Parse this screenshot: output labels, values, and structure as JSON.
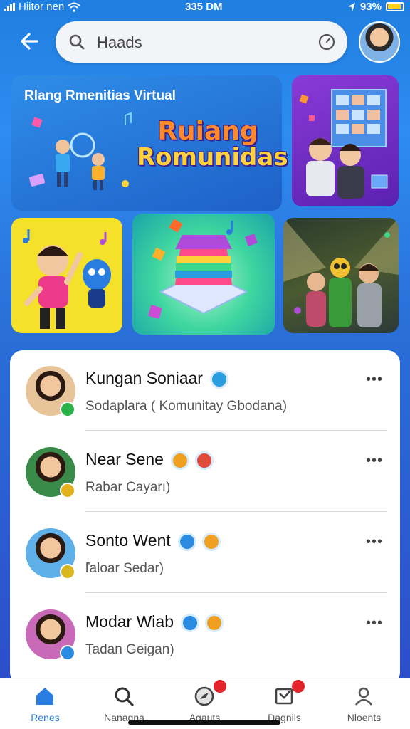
{
  "status_bar": {
    "carrier": "Hiitor nen",
    "time": "335 DM",
    "battery": "93%"
  },
  "search": {
    "placeholder": "Haads"
  },
  "banner": {
    "caption": "Rlang Rmenitias Virtual",
    "logo_line1": "Ruiang",
    "logo_line2": "Romunidas"
  },
  "contacts": [
    {
      "name": "Kungan Soniaar",
      "subtitle": "Sodaplara ( Komunitay Gbodana)",
      "status_color": "#2bb34a",
      "avatar_bg": "#e8c49a"
    },
    {
      "name": "Near Sene",
      "subtitle": "Rabar Cayarı)",
      "status_color": "#e2b11c",
      "avatar_bg": "#3a8a4a"
    },
    {
      "name": "Sonto Went",
      "subtitle": "ľaloar Sedar)",
      "status_color": "#d9b81f",
      "avatar_bg": "#5fb0e8"
    },
    {
      "name": "Modar Wiab",
      "subtitle": "Tadan Geigan)",
      "status_color": "#2a8be0",
      "avatar_bg": "#c86ab8"
    }
  ],
  "more_label": "•••",
  "nav": {
    "tabs": [
      {
        "label": "Renes",
        "icon": "home-icon",
        "active": true,
        "badge": false
      },
      {
        "label": "Nanaqna",
        "icon": "search-icon",
        "active": false,
        "badge": false
      },
      {
        "label": "Agauts",
        "icon": "explore-icon",
        "active": false,
        "badge": true
      },
      {
        "label": "Dagnils",
        "icon": "inbox-icon",
        "active": false,
        "badge": true
      },
      {
        "label": "Nloents",
        "icon": "profile-icon",
        "active": false,
        "badge": false
      }
    ]
  },
  "colors": {
    "accent": "#2a7de0",
    "background": "#2d6fd8",
    "badge": "#e5232a"
  }
}
